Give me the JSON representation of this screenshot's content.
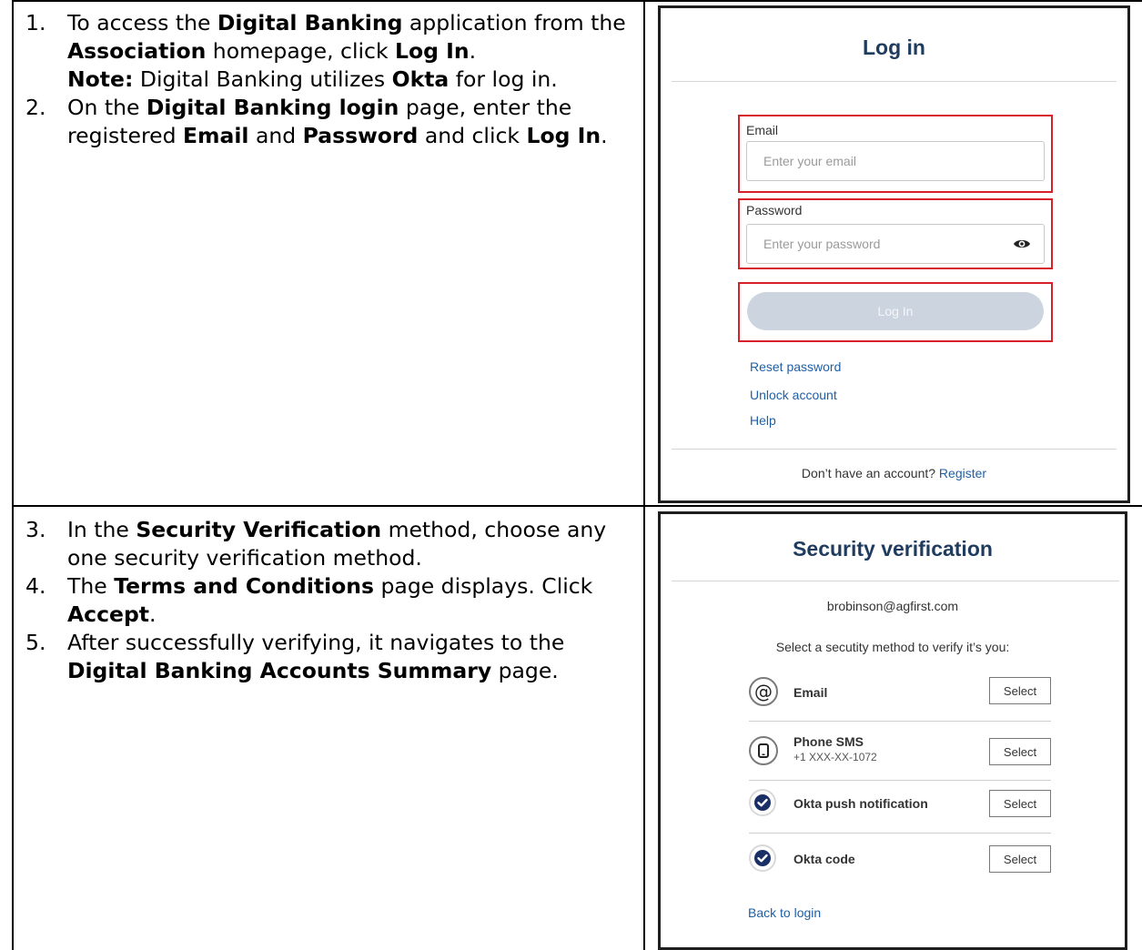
{
  "instructions_top": [
    {
      "num": "1.",
      "parts": [
        {
          "t": "To access the ",
          "b": false
        },
        {
          "t": "Digital Banking",
          "b": true
        },
        {
          "t": " application from the ",
          "b": false
        },
        {
          "t": "Association",
          "b": true
        },
        {
          "t": " homepage, click ",
          "b": false
        },
        {
          "t": "Log In",
          "b": true
        },
        {
          "t": ".",
          "b": false
        }
      ],
      "note": [
        {
          "t": "Note:",
          "b": true
        },
        {
          "t": " Digital Banking utilizes ",
          "b": false
        },
        {
          "t": "Okta",
          "b": true
        },
        {
          "t": " for log in.",
          "b": false
        }
      ]
    },
    {
      "num": "2.",
      "parts": [
        {
          "t": "On the ",
          "b": false
        },
        {
          "t": "Digital Banking login",
          "b": true
        },
        {
          "t": " page, enter the registered ",
          "b": false
        },
        {
          "t": "Email",
          "b": true
        },
        {
          "t": " and ",
          "b": false
        },
        {
          "t": "Password",
          "b": true
        },
        {
          "t": " and click ",
          "b": false
        },
        {
          "t": "Log In",
          "b": true
        },
        {
          "t": ".",
          "b": false
        }
      ]
    }
  ],
  "instructions_bottom": [
    {
      "num": "3.",
      "parts": [
        {
          "t": "In the ",
          "b": false
        },
        {
          "t": "Security Verification",
          "b": true
        },
        {
          "t": " method, choose any one security verification method.",
          "b": false
        }
      ]
    },
    {
      "num": "4.",
      "parts": [
        {
          "t": "The ",
          "b": false
        },
        {
          "t": "Terms and Conditions",
          "b": true
        },
        {
          "t": " page displays. Click ",
          "b": false
        },
        {
          "t": "Accept",
          "b": true
        },
        {
          "t": ".",
          "b": false
        }
      ]
    },
    {
      "num": "5.",
      "parts": [
        {
          "t": "After successfully verifying, it navigates to the ",
          "b": false
        },
        {
          "t": "Digital Banking Accounts Summary",
          "b": true
        },
        {
          "t": " page.",
          "b": false
        }
      ]
    }
  ],
  "login": {
    "title": "Log in",
    "email_label": "Email",
    "email_placeholder": "Enter your email",
    "password_label": "Password",
    "password_placeholder": "Enter your password",
    "login_button": "Log In",
    "reset_password": "Reset password",
    "unlock_account": "Unlock account",
    "help": "Help",
    "no_account": "Don’t have an account?",
    "register": "Register",
    "eye_icon": "eye-icon",
    "highlight_color": "#d8202a"
  },
  "security": {
    "title": "Security verification",
    "email": "brobinson@agfirst.com",
    "prompt": "Select a secutity method to verify it’s you:",
    "methods": [
      {
        "name": "Email",
        "sub": "",
        "icon": "at-sign-icon",
        "button": "Select"
      },
      {
        "name": "Phone SMS",
        "sub": "+1 XXX-XX-1072",
        "icon": "phone-icon",
        "button": "Select"
      },
      {
        "name": "Okta push notification",
        "sub": "",
        "icon": "okta-check-icon",
        "button": "Select"
      },
      {
        "name": "Okta code",
        "sub": "",
        "icon": "okta-check-icon",
        "button": "Select"
      }
    ],
    "back_to_login": "Back to login"
  },
  "colors": {
    "title": "#1f3b5e",
    "link": "#1f5fa6",
    "button_disabled": "#ccd5df"
  }
}
